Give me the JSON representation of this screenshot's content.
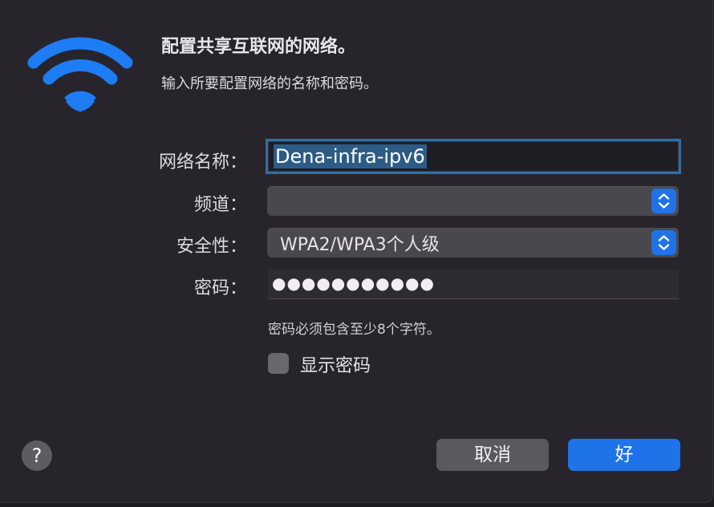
{
  "dialog": {
    "title": "配置共享互联网的网络。",
    "subtitle": "输入所要配置网络的名称和密码。"
  },
  "form": {
    "network_name_label": "网络名称：",
    "network_name_value": "Dena-infra-ipv6",
    "channel_label": "频道：",
    "channel_value": "",
    "security_label": "安全性：",
    "security_value": "WPA2/WPA3个人级",
    "password_label": "密码：",
    "password_masked": "●●●●●●●●●●●",
    "password_hint": "密码必须包含至少8个字符。",
    "show_password_label": "显示密码",
    "show_password_checked": false
  },
  "buttons": {
    "help": "?",
    "cancel": "取消",
    "ok": "好"
  },
  "icons": {
    "wifi": "wifi-icon",
    "stepper": "chevron-up-down-icon",
    "help": "question-mark-icon"
  },
  "colors": {
    "accent": "#1e73e8",
    "wifi_icon": "#1e7cf5",
    "background": "#27252b"
  }
}
